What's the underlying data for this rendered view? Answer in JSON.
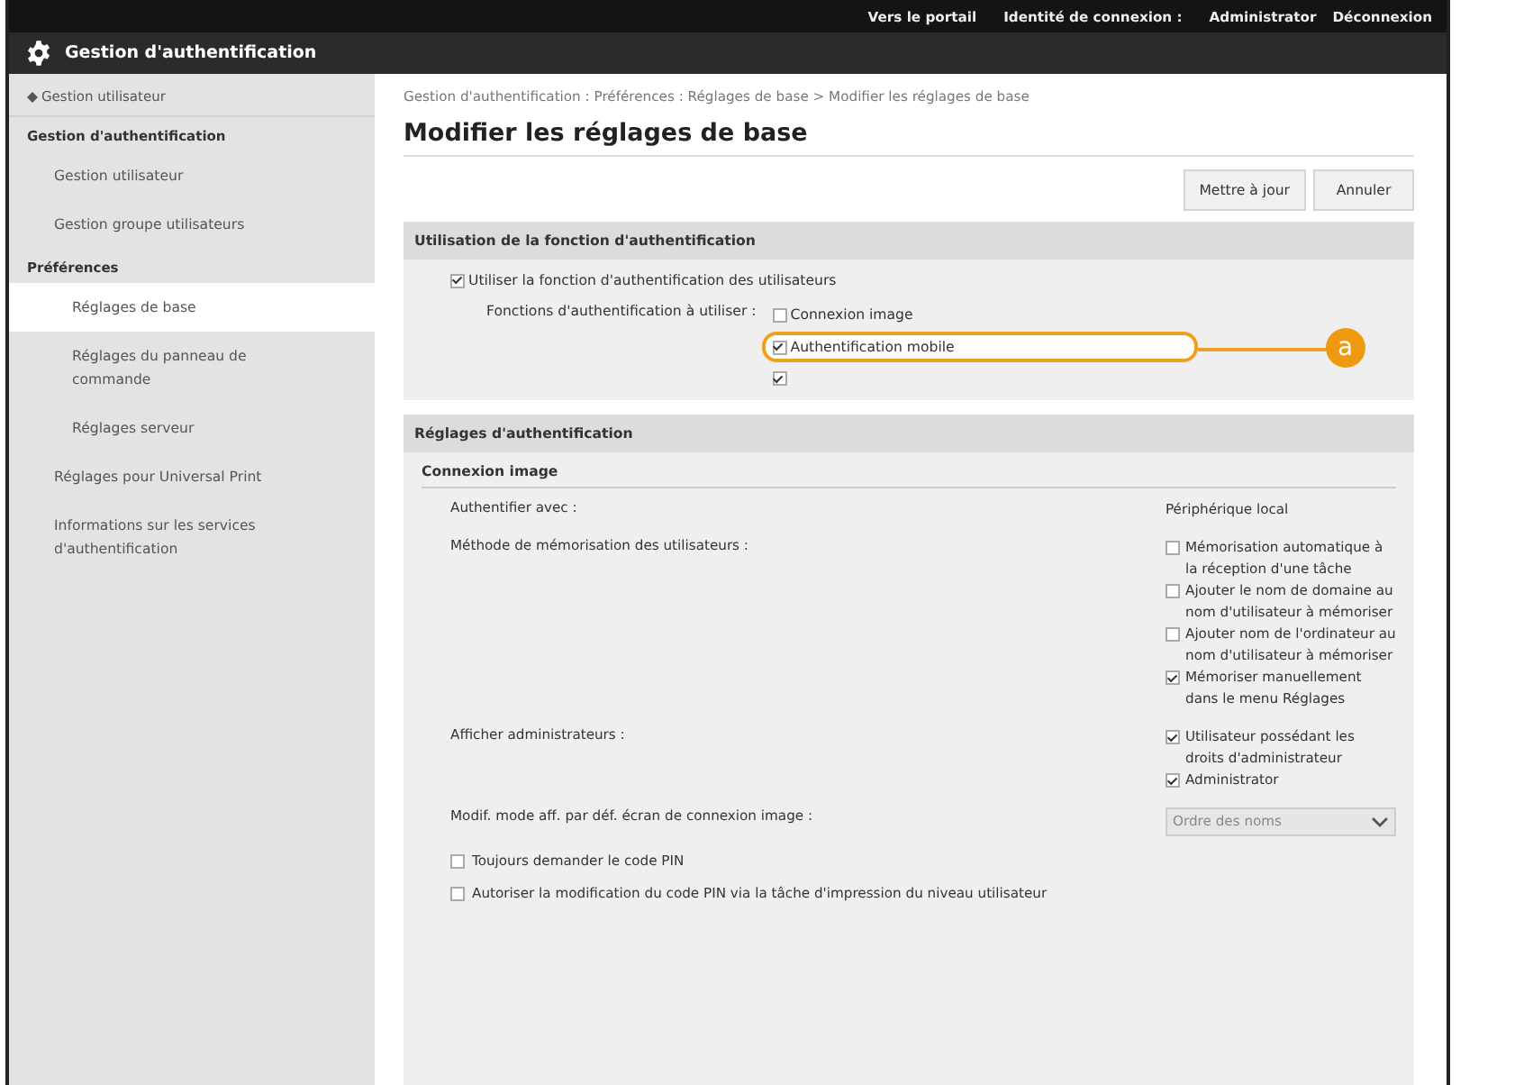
{
  "top_bar": {
    "links": [
      "Vers le portail",
      "Identité de connexion :",
      "Administrator",
      "Déconnexion"
    ]
  },
  "header": {
    "title": "Gestion d'authentification"
  },
  "sidebar": {
    "back_link": "Gestion utilisateur",
    "sections": [
      {
        "heading": "Gestion d'authentification",
        "items": [
          {
            "label": "Gestion utilisateur",
            "selected": false
          },
          {
            "label": "Gestion groupe utilisateurs",
            "selected": false
          }
        ]
      },
      {
        "heading": "Préférences",
        "items": [
          {
            "label": "Réglages de base",
            "selected": true
          },
          {
            "label": "Réglages du panneau de commande",
            "selected": false
          },
          {
            "label": "Réglages serveur",
            "selected": false
          }
        ]
      },
      {
        "items": [
          {
            "label": "Réglages pour Universal Print",
            "selected": false
          },
          {
            "label": "Informations sur les services d'authentification",
            "selected": false
          }
        ]
      }
    ]
  },
  "breadcrumb": "Gestion d'authentification : Préférences : Réglages de base > Modifier les réglages de base",
  "page_title": "Modifier les réglages de base",
  "buttons": [
    "Mettre à jour",
    "Annuler"
  ],
  "usage_section": {
    "heading": "Utilisation de la fonction d'authentification",
    "enable": {
      "label": "Utiliser la fonction d'authentification des utilisateurs",
      "checked": true
    },
    "functions_label": "Fonctions d'authentification à utiliser :",
    "functions": [
      {
        "label": "Connexion image",
        "checked": false,
        "highlighted": false
      },
      {
        "label": "Authentification mobile",
        "checked": true,
        "highlighted": true
      },
      {
        "checked": true,
        "highlighted": false
      }
    ]
  },
  "callout": {
    "letter": "a"
  },
  "auth_section": {
    "heading": "Réglages d'authentification",
    "subheading": "Connexion image",
    "rows": [
      {
        "kind": "text",
        "label": "Authentifier avec :",
        "value": "Périphérique local"
      },
      {
        "kind": "checks",
        "label": "Méthode de mémorisation des utilisateurs :",
        "options": [
          {
            "label": "Mémorisation automatique à la réception d'une tâche",
            "checked": false
          },
          {
            "label": "Ajouter le nom de domaine au nom d'utilisateur à mémoriser",
            "checked": false
          },
          {
            "label": "Ajouter nom de l'ordinateur au nom d'utilisateur à mémoriser",
            "checked": false
          },
          {
            "label": "Mémoriser manuellement dans le menu Réglages",
            "checked": true
          }
        ]
      },
      {
        "kind": "checks",
        "label": "Afficher administrateurs :",
        "options": [
          {
            "label": "Utilisateur possédant les droits d'administrateur",
            "checked": true
          },
          {
            "label": "Administrator",
            "checked": true
          }
        ]
      },
      {
        "kind": "select",
        "label": "Modif. mode aff. par déf. écran de connexion image :",
        "value": "Ordre des noms"
      },
      {
        "kind": "check",
        "label": "Toujours demander le code PIN",
        "checked": false
      },
      {
        "kind": "check",
        "label": "Autoriser la modification du code PIN via la tâche d'impression du niveau utilisateur",
        "checked": false
      }
    ]
  }
}
